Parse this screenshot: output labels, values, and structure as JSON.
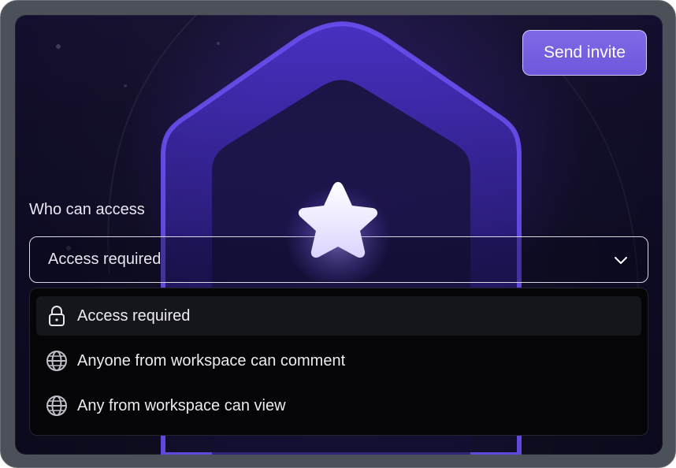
{
  "invite": {
    "label": "Send invite"
  },
  "access": {
    "label": "Who can access",
    "selected": "Access required",
    "options": [
      {
        "label": "Access required",
        "icon": "lock-icon",
        "selected": true
      },
      {
        "label": "Anyone from workspace can comment",
        "icon": "globe-icon",
        "selected": false
      },
      {
        "label": "Any from workspace can view",
        "icon": "globe-icon",
        "selected": false
      }
    ]
  },
  "colors": {
    "accent": "#7b63e3",
    "panel_bg": "#0d0b22",
    "shield": "#5b3fe0"
  }
}
